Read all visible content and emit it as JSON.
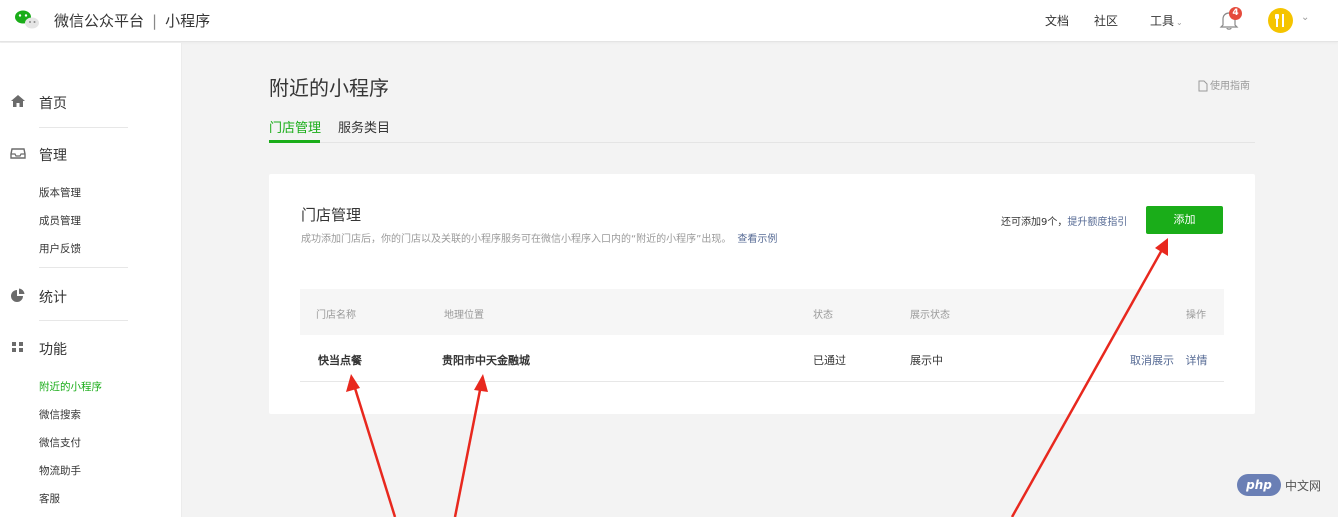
{
  "topbar": {
    "brand": "微信公众平台",
    "separator": "|",
    "product": "小程序",
    "links": [
      "文档",
      "社区",
      "工具"
    ],
    "notification_count": "4"
  },
  "sidebar": {
    "home": "首页",
    "manage": "管理",
    "manage_items": [
      "版本管理",
      "成员管理",
      "用户反馈"
    ],
    "stats": "统计",
    "features": "功能",
    "feature_items": [
      "附近的小程序",
      "微信搜索",
      "微信支付",
      "物流助手",
      "客服"
    ]
  },
  "page": {
    "title": "附近的小程序",
    "guide": "使用指南",
    "tabs": [
      "门店管理",
      "服务类目"
    ]
  },
  "card": {
    "title": "门店管理",
    "desc": "成功添加门店后，你的门店以及关联的小程序服务可在微信小程序入口内的“附近的小程序”出现。",
    "example_link": "查看示例",
    "quota_text": "还可添加9个，",
    "quota_link": "提升额度指引",
    "add_button": "添加",
    "table": {
      "headers": [
        "门店名称",
        "地理位置",
        "状态",
        "展示状态",
        "操作"
      ],
      "rows": [
        {
          "name": "快当点餐",
          "location": "贵阳市中天金融城",
          "status": "已通过",
          "display": "展示中",
          "action_cancel": "取消展示",
          "action_detail": "详情"
        }
      ]
    }
  },
  "watermark": {
    "logo": "php",
    "text": "中文网"
  },
  "colors": {
    "accent": "#1aad19",
    "link": "#576b95",
    "arrow": "#e8281e"
  }
}
